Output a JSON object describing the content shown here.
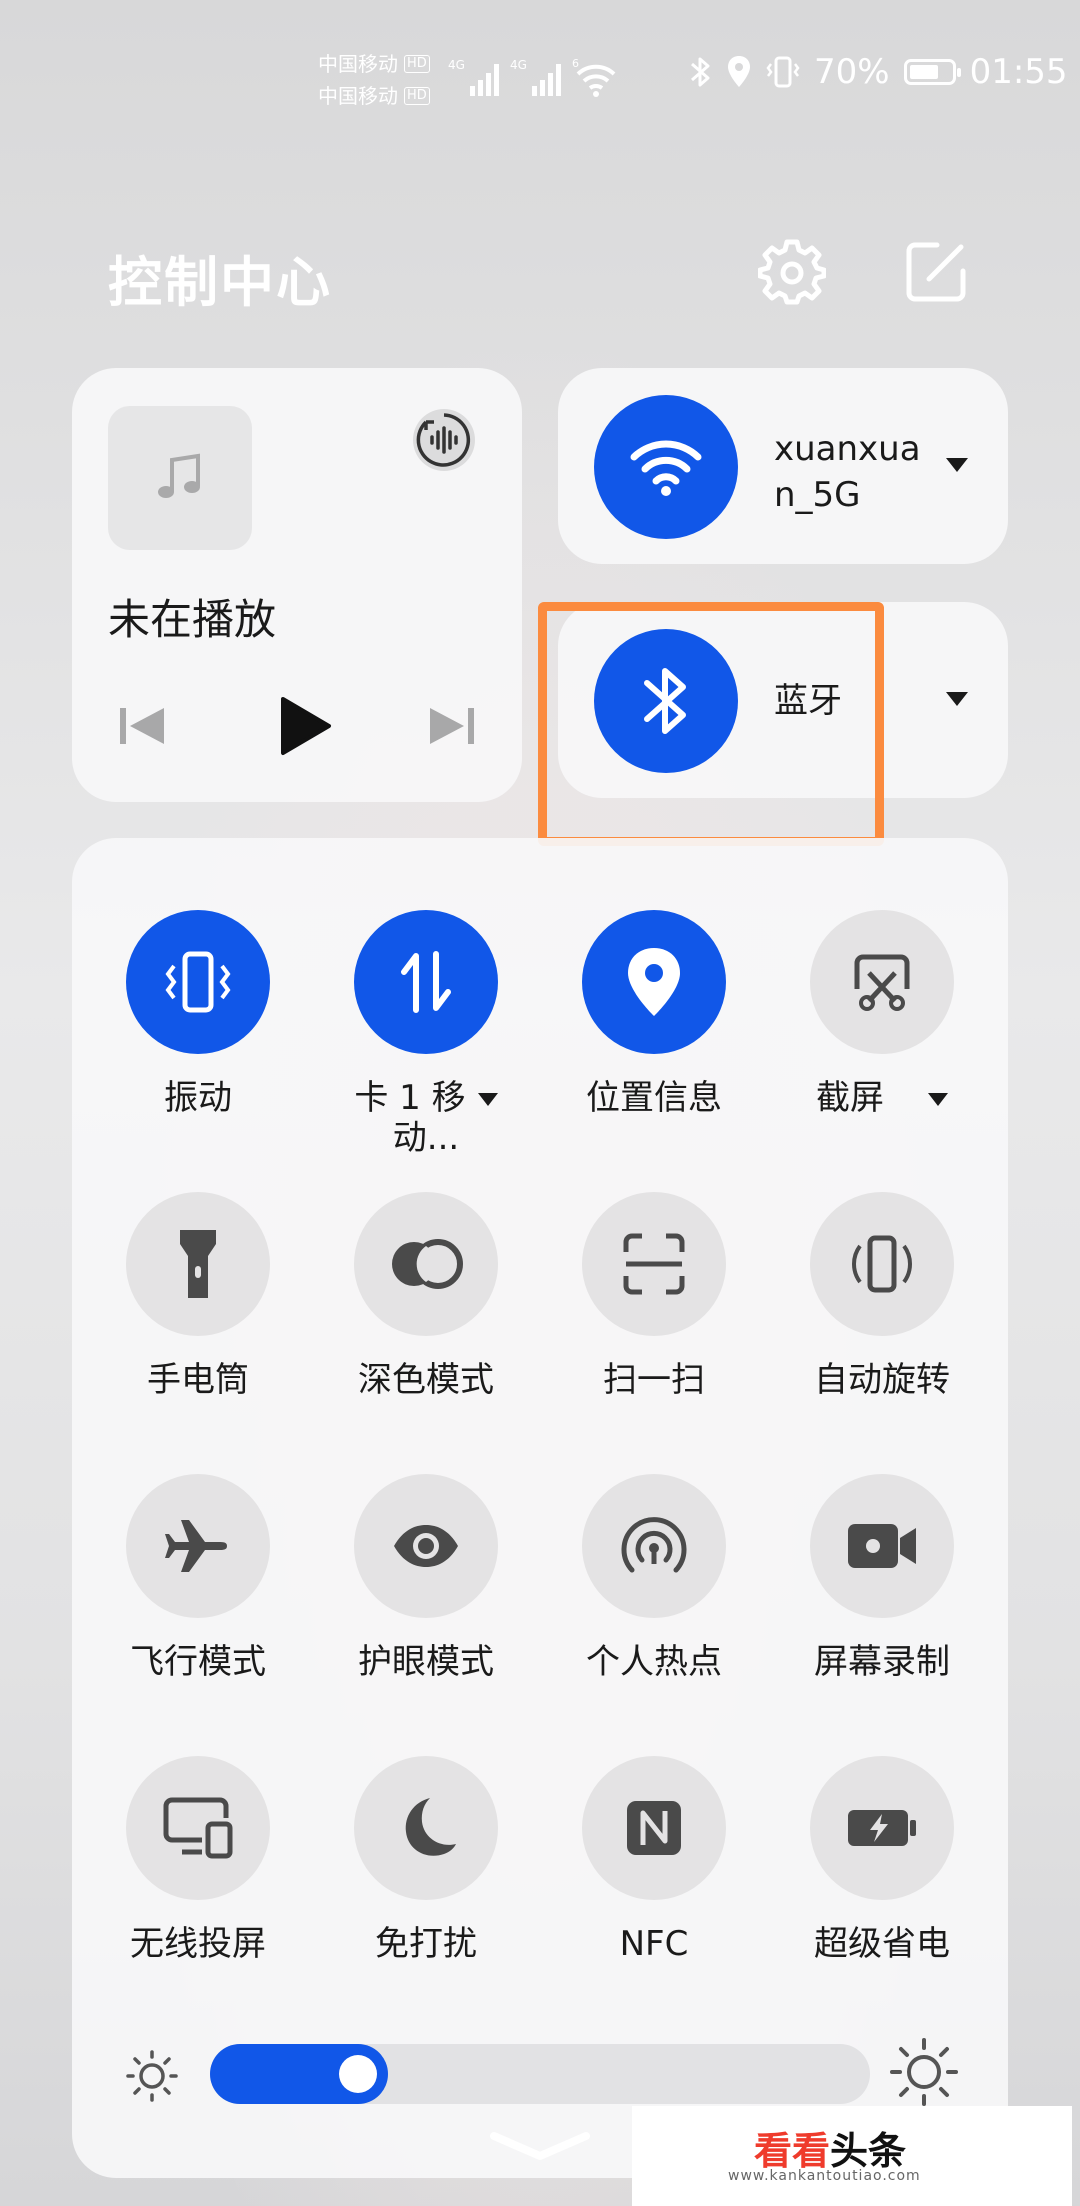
{
  "status_bar": {
    "carrier_1": "中国移动",
    "carrier_2": "中国移动",
    "hd_badge": "HD",
    "network_1": "4G",
    "network_2": "4G",
    "wifi_badge": "6",
    "battery_percent": "70%",
    "time": "01:55",
    "battery_level": 0.7
  },
  "header": {
    "title": "控制中心",
    "settings_icon": "gear-icon",
    "edit_icon": "edit-icon"
  },
  "media": {
    "status": "未在播放",
    "icons": [
      "music-note-icon",
      "audio-output-icon",
      "previous-icon",
      "play-icon",
      "next-icon"
    ]
  },
  "wifi": {
    "ssid": "xuanxuan_5G",
    "ssid_line1": "xuanxua",
    "ssid_line2": "n_5G",
    "icon": "wifi-icon"
  },
  "bluetooth": {
    "label": "蓝牙",
    "icon": "bluetooth-icon"
  },
  "tiles": [
    {
      "label": "振动",
      "icon": "vibrate-icon",
      "active": true
    },
    {
      "label": "卡 1 移",
      "label2": "动...",
      "icon": "mobile-data-icon",
      "active": true
    },
    {
      "label": "位置信息",
      "icon": "location-icon",
      "active": true
    },
    {
      "label": "截屏",
      "icon": "screenshot-icon",
      "active": false
    },
    {
      "label": "手电筒",
      "icon": "flashlight-icon",
      "active": false
    },
    {
      "label": "深色模式",
      "icon": "dark-mode-icon",
      "active": false
    },
    {
      "label": "扫一扫",
      "icon": "scan-icon",
      "active": false
    },
    {
      "label": "自动旋转",
      "icon": "auto-rotate-icon",
      "active": false
    },
    {
      "label": "飞行模式",
      "icon": "airplane-icon",
      "active": false
    },
    {
      "label": "护眼模式",
      "icon": "eye-comfort-icon",
      "active": false
    },
    {
      "label": "个人热点",
      "icon": "hotspot-icon",
      "active": false
    },
    {
      "label": "屏幕录制",
      "icon": "screen-record-icon",
      "active": false
    },
    {
      "label": "无线投屏",
      "icon": "wireless-projection-icon",
      "active": false
    },
    {
      "label": "免打扰",
      "icon": "do-not-disturb-icon",
      "active": false
    },
    {
      "label": "NFC",
      "icon": "nfc-icon",
      "active": false
    },
    {
      "label": "超级省电",
      "icon": "power-saving-icon",
      "active": false
    }
  ],
  "brightness": {
    "level": 0.27,
    "icon_low": "brightness-low-icon",
    "icon_high": "brightness-high-icon"
  },
  "watermark": {
    "brand_a": "看看",
    "brand_b": "头条",
    "url": "www.kankantoutiao.com"
  },
  "colors": {
    "accent": "#1157e8",
    "highlight": "#fb8b3f",
    "tile_off": "#e4e3e4"
  }
}
